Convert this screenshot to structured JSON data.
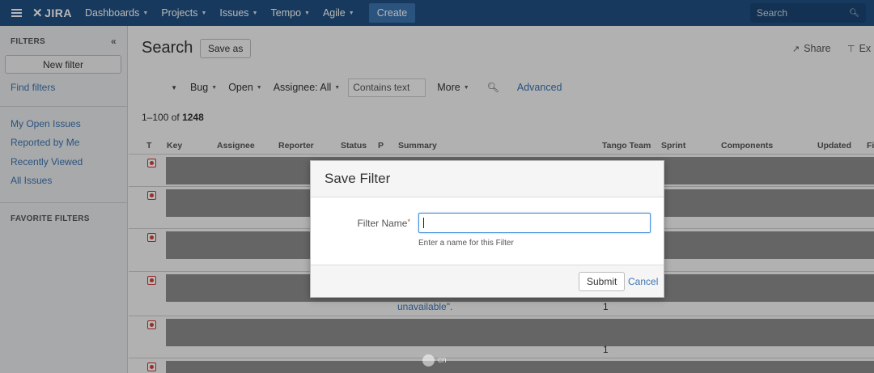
{
  "nav": {
    "logo": "JIRA",
    "items": [
      {
        "label": "Dashboards"
      },
      {
        "label": "Projects"
      },
      {
        "label": "Issues"
      },
      {
        "label": "Tempo"
      },
      {
        "label": "Agile"
      }
    ],
    "create_label": "Create",
    "search_placeholder": "Search"
  },
  "sidebar": {
    "header": "FILTERS",
    "new_filter_label": "New filter",
    "find_filters_label": "Find filters",
    "quick_filters": [
      "My Open Issues",
      "Reported by Me",
      "Recently Viewed",
      "All Issues"
    ],
    "favorite_header": "FAVORITE FILTERS"
  },
  "main": {
    "title": "Search",
    "save_as_label": "Save as",
    "share_label": "Share",
    "export_label": "Ex",
    "criteria": {
      "type": "Bug",
      "status": "Open",
      "assignee": "Assignee: All",
      "text_placeholder": "Contains text",
      "more": "More",
      "advanced": "Advanced"
    },
    "results": {
      "range": "1–100",
      "of_label": "of",
      "total": "1248"
    },
    "columns": [
      "T",
      "Key",
      "Assignee",
      "Reporter",
      "Status",
      "P",
      "Summary",
      "Tango Team",
      "Sprint",
      "Components",
      "Updated",
      "Fi"
    ],
    "visible_cells": {
      "summary_fragment": "unavailable\".",
      "tango_a": "1",
      "tango_b": "1"
    }
  },
  "dialog": {
    "title": "Save Filter",
    "field_label": "Filter Name",
    "required_mark": "*",
    "field_value": "",
    "hint": "Enter a name for this Filter",
    "submit_label": "Submit",
    "cancel_label": "Cancel"
  },
  "watermark": {
    "text": "cn"
  },
  "colors": {
    "nav_bg": "#205081",
    "accent": "#3b73af",
    "required": "#d04437"
  }
}
